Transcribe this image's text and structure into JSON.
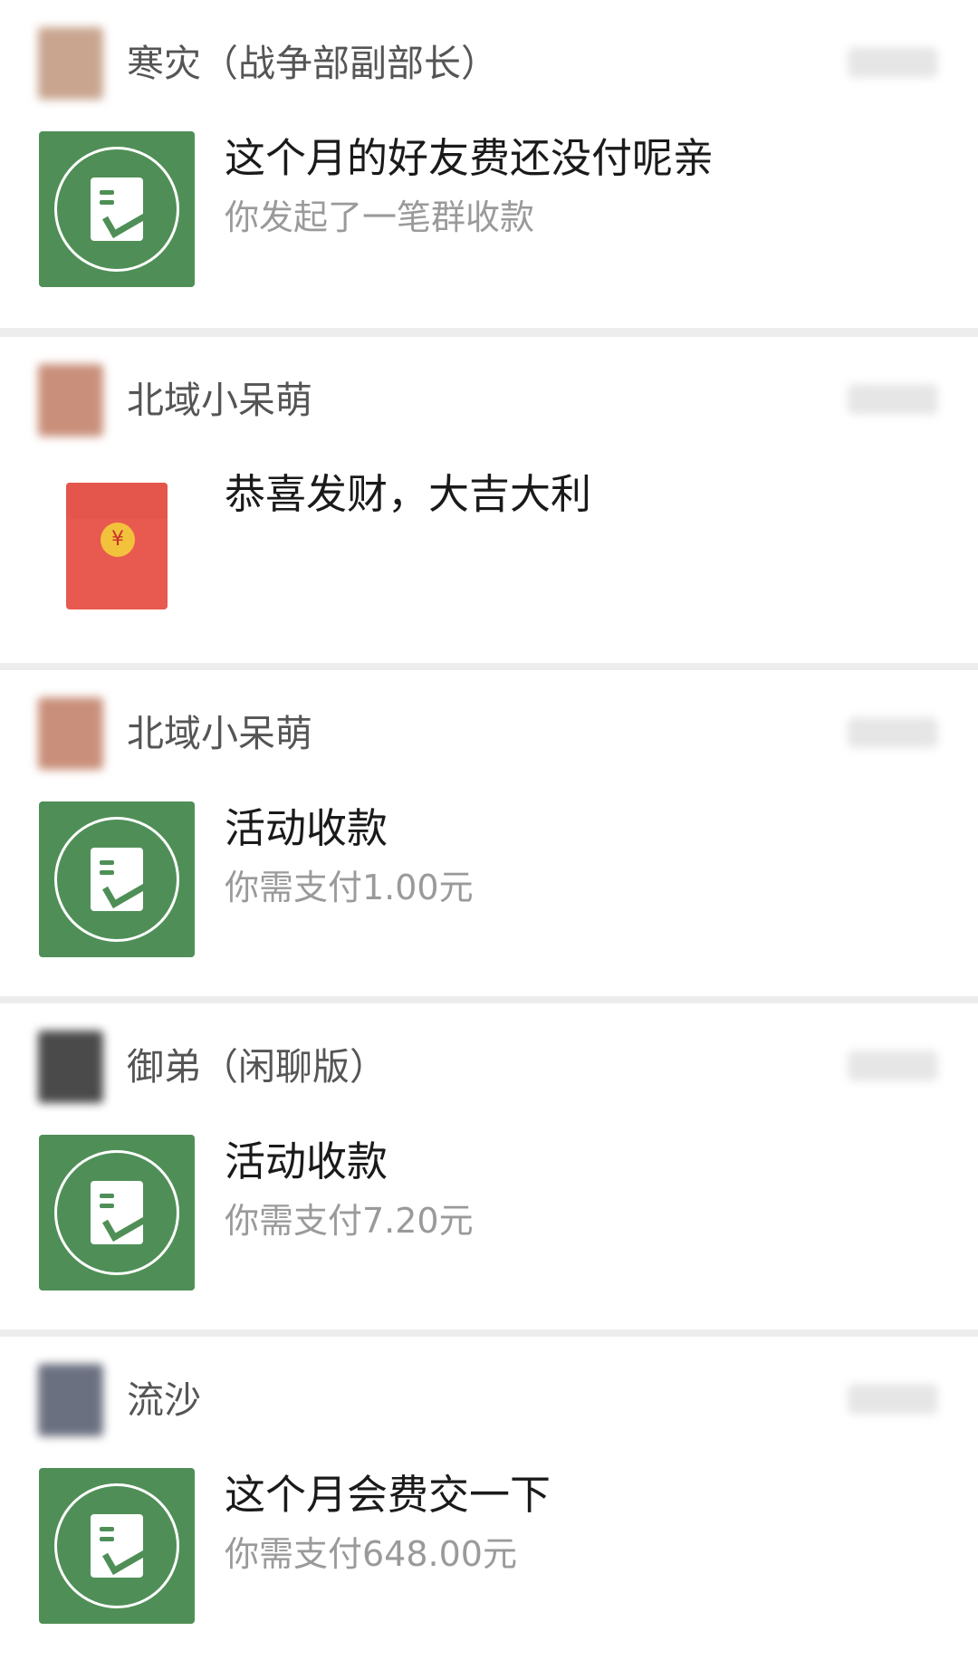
{
  "messages": [
    {
      "sender": "寒灾（战争部副部长）",
      "avatar_color": "#c9a590",
      "type": "group-collection",
      "title": "这个月的好友费还没付呢亲",
      "subtitle": "你发起了一笔群收款"
    },
    {
      "sender": "北域小呆萌",
      "avatar_color": "#c98f7a",
      "type": "red-packet",
      "title": "恭喜发财，大吉大利",
      "coin_symbol": "¥"
    },
    {
      "sender": "北域小呆萌",
      "avatar_color": "#c98f7a",
      "type": "group-collection",
      "title": "活动收款",
      "subtitle": "你需支付1.00元"
    },
    {
      "sender": "御弟（闲聊版）",
      "avatar_color": "#4a4a4a",
      "type": "group-collection",
      "title": "活动收款",
      "subtitle": "你需支付7.20元"
    },
    {
      "sender": "流沙",
      "avatar_color": "#6b7080",
      "type": "group-collection",
      "title": "这个月会费交一下",
      "subtitle": "你需支付648.00元"
    }
  ],
  "colors": {
    "collection_green": "#4f8f57",
    "red_packet": "#e85a4f",
    "coin": "#f3c23c",
    "divider": "#ededed"
  },
  "icons": {
    "collection": "payment-request-icon",
    "red_packet": "red-packet-icon"
  }
}
